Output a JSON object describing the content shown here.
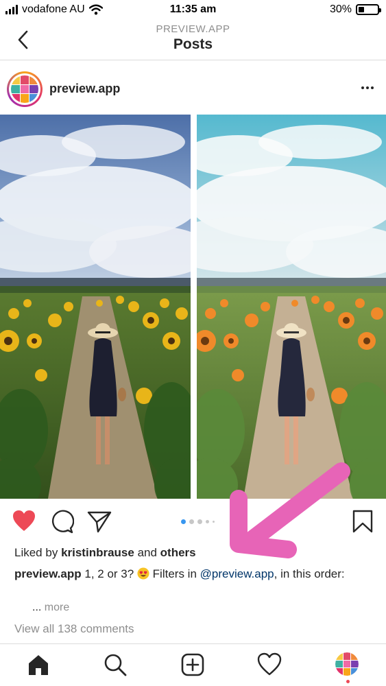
{
  "status_bar": {
    "carrier": "vodafone AU",
    "time": "11:35 am",
    "battery": "30%",
    "battery_level": 0.3
  },
  "header": {
    "subtitle": "PREVIEW.APP",
    "title": "Posts",
    "back_icon": "chevron-left-icon"
  },
  "post": {
    "username": "preview.app",
    "menu_icon": "more-horizontal-icon",
    "carousel": {
      "total": 5,
      "active_index": 0
    },
    "liked_prefix": "Liked by",
    "liked_user": "kristinbrause",
    "liked_and": "and",
    "liked_others": "others",
    "caption_user": "preview.app",
    "caption_text_1": "1, 2 or 3?",
    "caption_text_2": "Filters in",
    "caption_mention": "@preview.app",
    "caption_text_3": ", in this order:",
    "more_ellipsis": "...",
    "more_label": "more",
    "view_comments": "View all 138 comments"
  },
  "actions": {
    "like_icon": "heart-filled-icon",
    "comment_icon": "comment-icon",
    "share_icon": "paper-plane-icon",
    "save_icon": "bookmark-icon"
  },
  "tab_bar": {
    "items": [
      "home-icon",
      "search-icon",
      "add-post-icon",
      "activity-heart-icon",
      "profile-avatar-icon"
    ]
  },
  "colors": {
    "like_red": "#ed4956",
    "link_blue": "#003569",
    "carousel_active": "#3897f0",
    "annotation_pink": "#e764b7",
    "muted_gray": "#8e8e8e"
  }
}
